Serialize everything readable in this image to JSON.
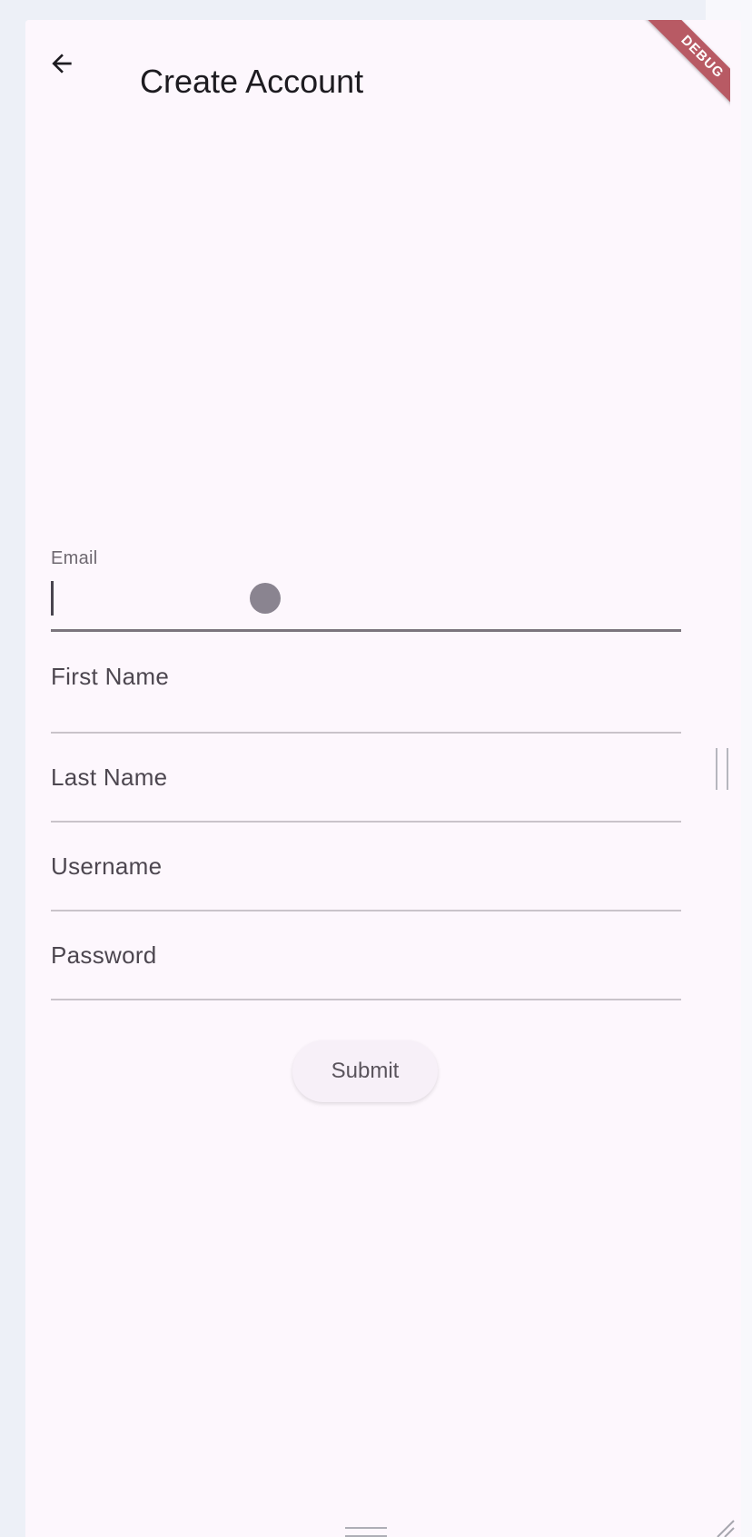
{
  "appbar": {
    "back_icon": "arrow-back-icon",
    "title": "Create Account"
  },
  "debug_banner": "DEBUG",
  "form": {
    "email": {
      "label": "Email",
      "value": ""
    },
    "first_name": {
      "label": "First Name",
      "value": ""
    },
    "last_name": {
      "label": "Last Name",
      "value": ""
    },
    "username": {
      "label": "Username",
      "value": ""
    },
    "password": {
      "label": "Password",
      "value": ""
    },
    "submit_label": "Submit"
  },
  "colors": {
    "background": "#fdf7fd",
    "debug_ribbon": "#b85a64",
    "text": "#1d1b20"
  }
}
